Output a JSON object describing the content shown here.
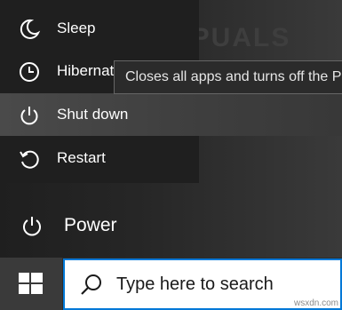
{
  "power_menu": {
    "items": [
      {
        "label": "Sleep",
        "icon": "moon-icon"
      },
      {
        "label": "Hibernate",
        "icon": "clock-icon"
      },
      {
        "label": "Shut down",
        "icon": "power-icon"
      },
      {
        "label": "Restart",
        "icon": "restart-icon"
      }
    ]
  },
  "tooltip": {
    "text": "Closes all apps and turns off the PC."
  },
  "watermark": {
    "text": "APPUALS"
  },
  "power_button": {
    "label": "Power",
    "icon": "power-icon"
  },
  "taskbar": {
    "start_icon": "windows-logo-icon",
    "search_placeholder": "Type here to search",
    "search_icon": "search-icon"
  },
  "credit": {
    "text": "wsxdn.com"
  },
  "colors": {
    "accent": "#0078d7",
    "menu_bg": "#1f1f1f",
    "selected_bg": "#4a4a4a"
  }
}
